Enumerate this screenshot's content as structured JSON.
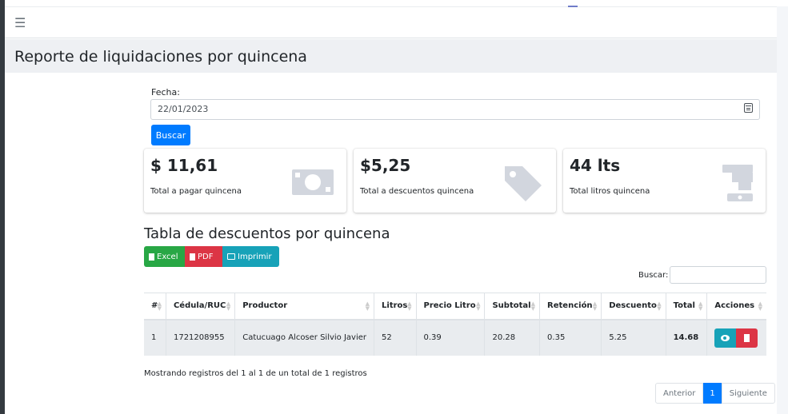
{
  "page": {
    "title": "Reporte de liquidaciones por quincena"
  },
  "filter": {
    "date_label": "Fecha:",
    "date_value": "22/01/2023",
    "search_button": "Buscar"
  },
  "cards": [
    {
      "value": "$ 11,61",
      "label": "Total a pagar quincena",
      "icon": "money-bill-icon"
    },
    {
      "value": "$5,25",
      "label": "Total a descuentos quincena",
      "icon": "tag-icon"
    },
    {
      "value": "44 lts",
      "label": "Total litros quincena",
      "icon": "faucet-icon"
    }
  ],
  "table_section": {
    "title": "Tabla de descuentos por quincena",
    "export": {
      "excel": "Excel",
      "pdf": "PDF",
      "print": "Imprimir"
    },
    "search_label": "Buscar:",
    "columns": [
      "#",
      "Cédula/RUC",
      "Productor",
      "Litros",
      "Precio Litro",
      "Subtotal",
      "Retención",
      "Descuento",
      "Total",
      "Acciones"
    ],
    "rows": [
      {
        "num": "1",
        "cedula": "1721208955",
        "productor": "Catucuago Alcoser Silvio Javier",
        "litros": "52",
        "precio": "0.39",
        "subtotal": "20.28",
        "retencion": "0.35",
        "descuento": "5.25",
        "total": "14.68"
      }
    ],
    "info": "Mostrando registros del 1 al 1 de un total de 1 registros",
    "pagination": {
      "prev": "Anterior",
      "current": "1",
      "next": "Siguiente"
    }
  },
  "colors": {
    "primary": "#007bff",
    "success": "#28a745",
    "danger": "#dc3545",
    "info": "#17a2b8",
    "icon_gray": "#d2d6de"
  }
}
